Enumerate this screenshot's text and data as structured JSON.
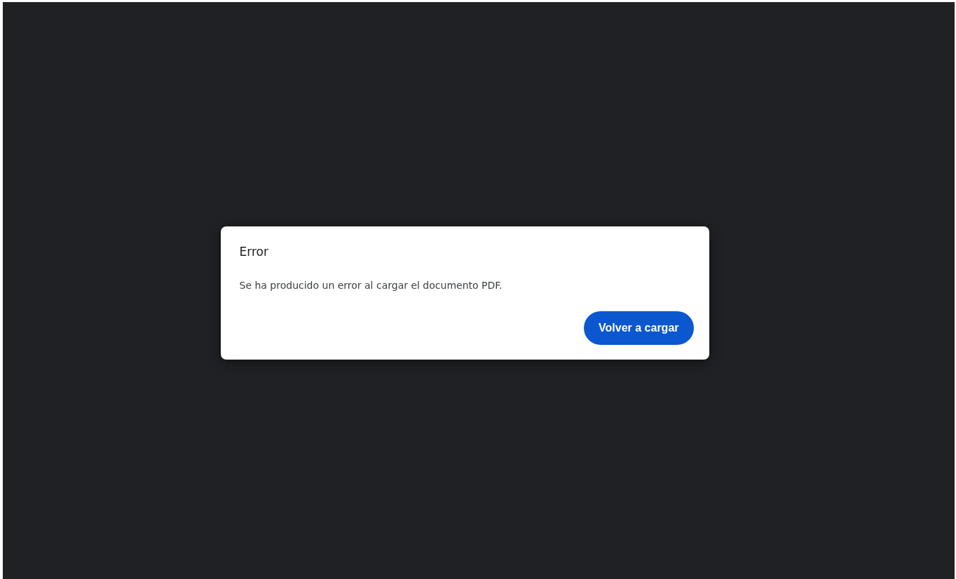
{
  "dialog": {
    "title": "Error",
    "message": "Se ha producido un error al cargar el documento PDF.",
    "button": "Volver a cargar"
  }
}
